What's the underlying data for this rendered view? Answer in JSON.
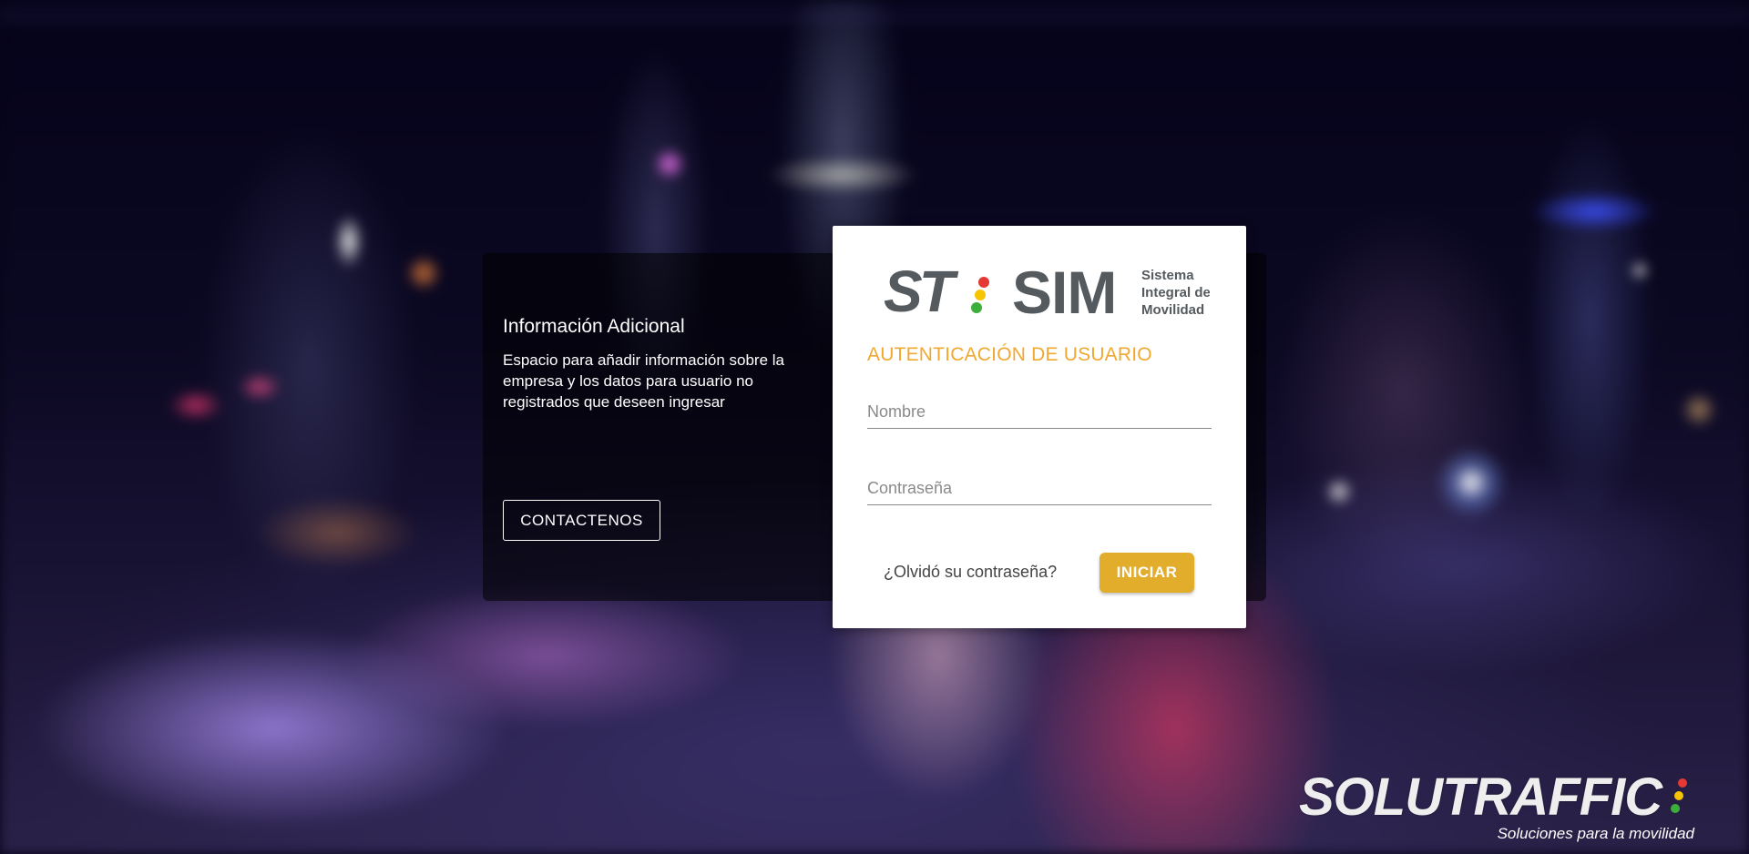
{
  "info": {
    "title": "Información Adicional",
    "text": "Espacio para añadir información sobre la empresa y los datos para usuario no registrados que deseen ingresar",
    "contact_label": "CONTACTENOS"
  },
  "login": {
    "logo": {
      "mark": "ST",
      "product": "SIM",
      "subtitle_lines": [
        "Sistema",
        "Integral de",
        "Movilidad"
      ]
    },
    "title": "AUTENTICACIÓN DE USUARIO",
    "username_placeholder": "Nombre",
    "password_placeholder": "Contraseña",
    "forgot_label": "¿Olvidó su contraseña?",
    "submit_label": "INICIAR"
  },
  "brand": {
    "name": "SOLUTRAFFIC",
    "tagline": "Soluciones para la movilidad"
  },
  "colors": {
    "accent": "#f0a830",
    "button": "#e2ad2b",
    "logo_grey": "#555a5e",
    "light_red": "#e53935",
    "light_yellow": "#f6c400",
    "light_green": "#3cae3c"
  }
}
